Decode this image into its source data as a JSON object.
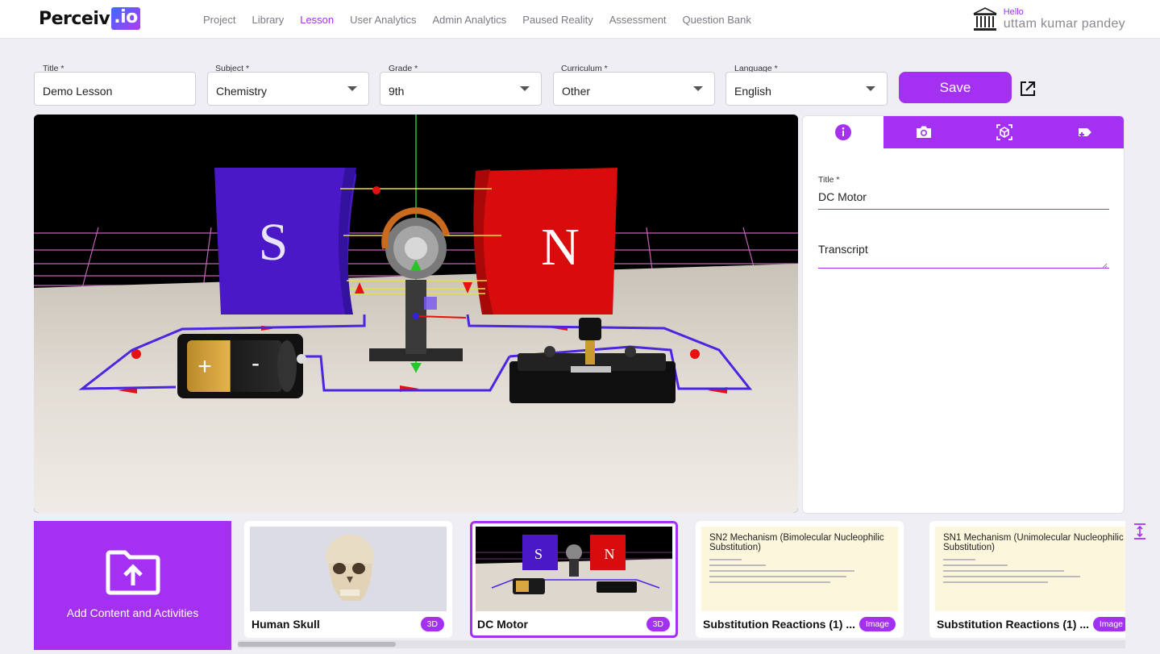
{
  "header": {
    "logo_text": "Perceiv",
    "logo_suffix": ".io",
    "nav": [
      "Project",
      "Library",
      "Lesson",
      "User Analytics",
      "Admin Analytics",
      "Paused Reality",
      "Assessment",
      "Question Bank"
    ],
    "active_nav": "Lesson",
    "greeting": "Hello",
    "user_name": "uttam kumar pandey",
    "user_icon": "institution-icon"
  },
  "form": {
    "title_label": "Title *",
    "title_value": "Demo Lesson",
    "subject_label": "Subject *",
    "subject_value": "Chemistry",
    "grade_label": "Grade *",
    "grade_value": "9th",
    "curriculum_label": "Curriculum *",
    "curriculum_value": "Other",
    "language_label": "Language *",
    "language_value": "English",
    "save_label": "Save",
    "open_icon": "open-external-icon"
  },
  "viewer": {
    "scene": "dc-motor",
    "magnet_left": "S",
    "magnet_right": "N",
    "battery_plus": "+",
    "battery_minus": "-"
  },
  "panel": {
    "tabs": [
      {
        "icon": "info-icon",
        "active": true
      },
      {
        "icon": "camera-icon",
        "active": false
      },
      {
        "icon": "ar-cube-icon",
        "active": false
      },
      {
        "icon": "add-activity-icon",
        "active": false
      }
    ],
    "title_label": "Title *",
    "title_value": "DC Motor",
    "transcript_placeholder": "Transcript"
  },
  "content_strip": {
    "add_label": "Add Content and Activities",
    "add_icon": "folder-upload-icon",
    "items": [
      {
        "title": "Human Skull",
        "badge": "3D",
        "selected": false
      },
      {
        "title": "DC Motor",
        "badge": "3D",
        "selected": true
      },
      {
        "title": "Substitution Reactions (1) ...",
        "badge": "Image",
        "selected": false,
        "doc_heading": "SN2 Mechanism (Bimolecular Nucleophilic Substitution)"
      },
      {
        "title": "Substitution Reactions (1) ...",
        "badge": "Image",
        "selected": false,
        "doc_heading": "SN1 Mechanism (Unimolecular Nucleophilic Substitution)"
      }
    ],
    "expand_icon": "expand-vertical-icon"
  },
  "colors": {
    "accent": "#a431f2",
    "background": "#eeeef4"
  }
}
